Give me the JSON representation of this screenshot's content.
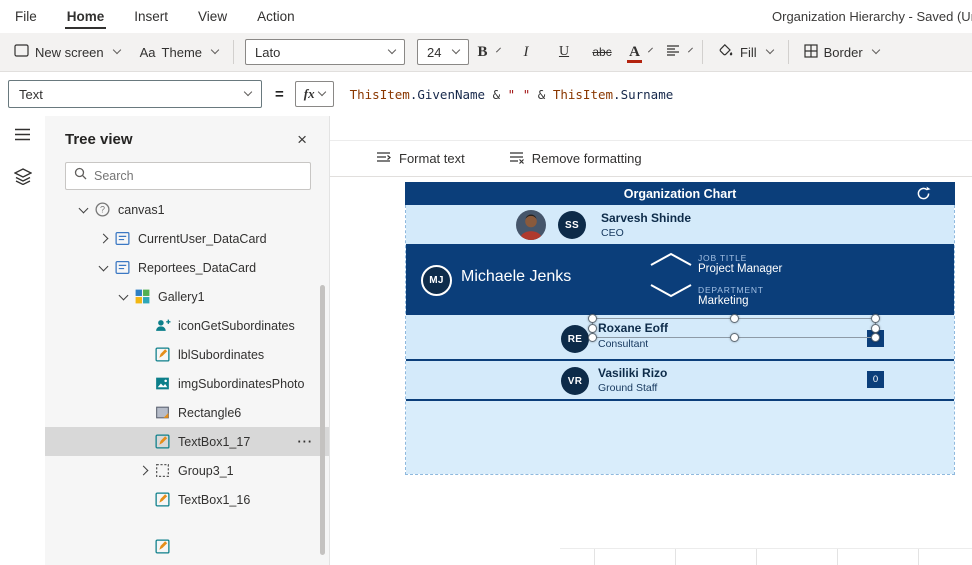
{
  "menubar": {
    "items": [
      {
        "label": "File"
      },
      {
        "label": "Home"
      },
      {
        "label": "Insert"
      },
      {
        "label": "View"
      },
      {
        "label": "Action"
      }
    ],
    "active_item": "Home",
    "document_title": "Organization Hierarchy - Saved (Unpublished)"
  },
  "toolbar": {
    "new_screen_label": "New screen",
    "theme_label": "Theme",
    "theme_icon": "Aa",
    "font_name": "Lato",
    "font_size": "24",
    "bold_label": "B",
    "italic_label": "I",
    "underline_label": "U",
    "strikethrough_label": "abc",
    "font_color_label": "A",
    "fill_label": "Fill",
    "border_label": "Border"
  },
  "formula_bar": {
    "property_selected": "Text",
    "equals_sign": "=",
    "fx_label": "fx",
    "formula_text": "ThisItem.GivenName & \" \" & ThisItem.Surname",
    "tokens": [
      {
        "text": "ThisItem",
        "type": "entity"
      },
      {
        "text": ".GivenName",
        "type": "property"
      },
      {
        "text": " & ",
        "type": "operator"
      },
      {
        "text": "\" \"",
        "type": "string"
      },
      {
        "text": " & ",
        "type": "operator"
      },
      {
        "text": "ThisItem",
        "type": "entity"
      },
      {
        "text": ".Surname",
        "type": "property"
      }
    ]
  },
  "format_bar": {
    "format_text_label": "Format text",
    "remove_formatting_label": "Remove formatting"
  },
  "tree_view": {
    "title": "Tree view",
    "search_placeholder": "Search",
    "items": [
      {
        "label": "canvas1",
        "icon": "canvas",
        "level": 1,
        "chevron": "down",
        "selected": false
      },
      {
        "label": "CurrentUser_DataCard",
        "icon": "datacard",
        "level": 2,
        "chevron": "right",
        "selected": false
      },
      {
        "label": "Reportees_DataCard",
        "icon": "datacard",
        "level": 2,
        "chevron": "down",
        "selected": false
      },
      {
        "label": "Gallery1",
        "icon": "gallery",
        "level": 3,
        "chevron": "down",
        "selected": false
      },
      {
        "label": "iconGetSubordinates",
        "icon": "icon-control",
        "level": 4,
        "chevron": "none",
        "selected": false
      },
      {
        "label": "lblSubordinates",
        "icon": "label",
        "level": 4,
        "chevron": "none",
        "selected": false
      },
      {
        "label": "imgSubordinatesPhoto",
        "icon": "image",
        "level": 4,
        "chevron": "none",
        "selected": false
      },
      {
        "label": "Rectangle6",
        "icon": "rectangle",
        "level": 4,
        "chevron": "none",
        "selected": false
      },
      {
        "label": "TextBox1_17",
        "icon": "label",
        "level": 4,
        "chevron": "none",
        "selected": true
      },
      {
        "label": "Group3_1",
        "icon": "group",
        "level": 4,
        "chevron": "right",
        "selected": false
      },
      {
        "label": "TextBox1_16",
        "icon": "label",
        "level": 4,
        "chevron": "none",
        "selected": false
      },
      {
        "label": "",
        "icon": "label",
        "level": 4,
        "chevron": "none",
        "selected": false,
        "partial": true
      }
    ]
  },
  "org_chart": {
    "header_title": "Organization Chart",
    "ceo": {
      "initials": "SS",
      "name": "Sarvesh Shinde",
      "title": "CEO"
    },
    "manager": {
      "initials": "MJ",
      "name": "Michaele Jenks",
      "job_title_label": "JOB TITLE",
      "job_title": "Project Manager",
      "department_label": "DEPARTMENT",
      "department": "Marketing"
    },
    "consultant": {
      "initials": "RE",
      "name": "Roxane Eoff",
      "title": "Consultant"
    },
    "staff": {
      "initials": "VR",
      "name": "Vasiliki Rizo",
      "title": "Ground Staff",
      "badge_count": "0"
    }
  },
  "icons": {
    "rail": [
      "hamburger-menu-icon",
      "tree-view-layers-icon"
    ],
    "tree_header": [
      "search-icon",
      "close-icon"
    ],
    "org_chart": [
      "refresh-icon",
      "chevron-up-icon",
      "chevron-down-icon"
    ]
  },
  "colors": {
    "brand_navy": "#0b3e7a",
    "row_light_blue": "#d4eafa",
    "row_empty_blue": "#d9edfb",
    "initials_navy": "#0d2b49",
    "selected_tree_item_bg": "#d8d8d8"
  }
}
